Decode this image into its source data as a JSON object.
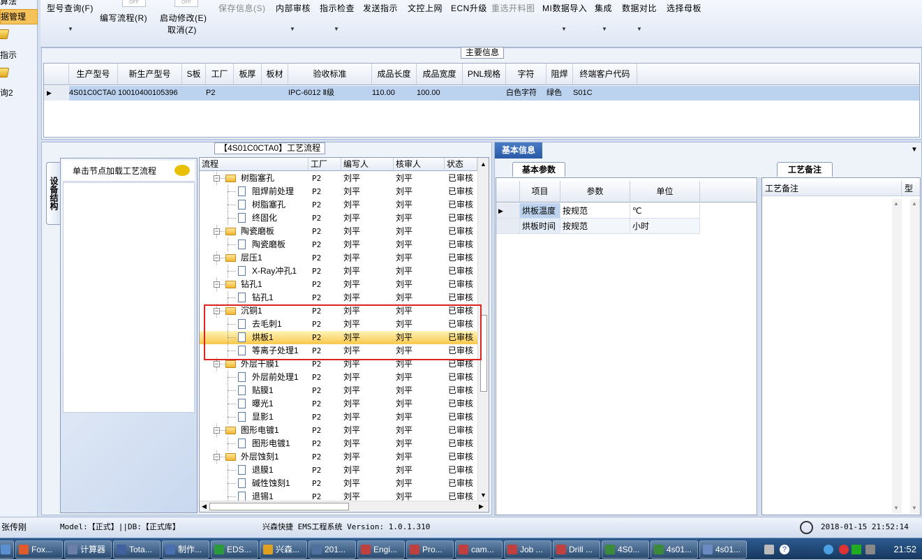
{
  "left_nav": {
    "items": [
      {
        "label": "算法",
        "selected": false
      },
      {
        "label": "据管理",
        "selected": true
      },
      {
        "label": "指示",
        "selected": false
      },
      {
        "label": "询2",
        "selected": false
      }
    ]
  },
  "toolbar": {
    "items": [
      {
        "label": "型号查询(F)",
        "enabled": true
      },
      {
        "label": "编写流程(R)",
        "enabled": true
      },
      {
        "label": "启动修改(E)",
        "enabled": true
      },
      {
        "label": "取消(Z)",
        "enabled": true
      },
      {
        "label": "保存信息(S)",
        "enabled": false
      },
      {
        "label": "内部审核",
        "enabled": true
      },
      {
        "label": "指示检查",
        "enabled": true
      },
      {
        "label": "发送指示",
        "enabled": true
      },
      {
        "label": "文控上网",
        "enabled": true
      },
      {
        "label": "ECN升级",
        "enabled": true
      },
      {
        "label": "重选开料图",
        "enabled": false
      },
      {
        "label": "MI数据导入",
        "enabled": true
      },
      {
        "label": "集成",
        "enabled": true
      },
      {
        "label": "数据对比",
        "enabled": true
      },
      {
        "label": "选择母板",
        "enabled": true
      }
    ],
    "off_label": "OFF"
  },
  "main_info": {
    "title": "主要信息",
    "columns": [
      "生产型号",
      "新生产型号",
      "S板",
      "工厂",
      "板厚",
      "板材",
      "验收标准",
      "成品长度",
      "成品宽度",
      "PNL规格",
      "字符",
      "阻焊",
      "终端客户代码"
    ],
    "rows": [
      [
        "4S01C0CTA0",
        "10010400105396",
        "",
        "P2",
        "",
        "",
        "IPC-6012 Ⅱ级",
        "110.00",
        "100.00",
        "",
        "白色字符",
        "绿色",
        "S01C"
      ]
    ]
  },
  "process": {
    "title": "【4S01C0CTA0】工艺流程",
    "side_tab": "设备结构",
    "node_hint": "单击节点加载工艺流程",
    "columns": [
      "流程",
      "工厂",
      "编写人",
      "核审人",
      "状态"
    ],
    "rows": [
      {
        "name": "树脂塞孔",
        "level": 0,
        "factory": "P2",
        "writer": "刘平",
        "reviewer": "刘平",
        "status": "已审核"
      },
      {
        "name": "阻焊前处理",
        "level": 1,
        "factory": "P2",
        "writer": "刘平",
        "reviewer": "刘平",
        "status": "已审核"
      },
      {
        "name": "树脂塞孔",
        "level": 1,
        "factory": "P2",
        "writer": "刘平",
        "reviewer": "刘平",
        "status": "已审核"
      },
      {
        "name": "终固化",
        "level": 1,
        "factory": "P2",
        "writer": "刘平",
        "reviewer": "刘平",
        "status": "已审核"
      },
      {
        "name": "陶瓷磨板",
        "level": 0,
        "factory": "P2",
        "writer": "刘平",
        "reviewer": "刘平",
        "status": "已审核"
      },
      {
        "name": "陶瓷磨板",
        "level": 1,
        "factory": "P2",
        "writer": "刘平",
        "reviewer": "刘平",
        "status": "已审核"
      },
      {
        "name": "层压1",
        "level": 0,
        "factory": "P2",
        "writer": "刘平",
        "reviewer": "刘平",
        "status": "已审核"
      },
      {
        "name": "X-Ray冲孔1",
        "level": 1,
        "factory": "P2",
        "writer": "刘平",
        "reviewer": "刘平",
        "status": "已审核"
      },
      {
        "name": "钻孔1",
        "level": 0,
        "factory": "P2",
        "writer": "刘平",
        "reviewer": "刘平",
        "status": "已审核"
      },
      {
        "name": "钻孔1",
        "level": 1,
        "factory": "P2",
        "writer": "刘平",
        "reviewer": "刘平",
        "status": "已审核"
      },
      {
        "name": "沉铜1",
        "level": 0,
        "factory": "P2",
        "writer": "刘平",
        "reviewer": "刘平",
        "status": "已审核"
      },
      {
        "name": "去毛刺1",
        "level": 1,
        "factory": "P2",
        "writer": "刘平",
        "reviewer": "刘平",
        "status": "已审核"
      },
      {
        "name": "烘板1",
        "level": 1,
        "factory": "P2",
        "writer": "刘平",
        "reviewer": "刘平",
        "status": "已审核",
        "selected": true
      },
      {
        "name": "等离子处理1",
        "level": 1,
        "factory": "P2",
        "writer": "刘平",
        "reviewer": "刘平",
        "status": "已审核"
      },
      {
        "name": "外层干膜1",
        "level": 0,
        "factory": "P2",
        "writer": "刘平",
        "reviewer": "刘平",
        "status": "已审核"
      },
      {
        "name": "外层前处理1",
        "level": 1,
        "factory": "P2",
        "writer": "刘平",
        "reviewer": "刘平",
        "status": "已审核"
      },
      {
        "name": "贴膜1",
        "level": 1,
        "factory": "P2",
        "writer": "刘平",
        "reviewer": "刘平",
        "status": "已审核"
      },
      {
        "name": "曝光1",
        "level": 1,
        "factory": "P2",
        "writer": "刘平",
        "reviewer": "刘平",
        "status": "已审核"
      },
      {
        "name": "显影1",
        "level": 1,
        "factory": "P2",
        "writer": "刘平",
        "reviewer": "刘平",
        "status": "已审核"
      },
      {
        "name": "图形电镀1",
        "level": 0,
        "factory": "P2",
        "writer": "刘平",
        "reviewer": "刘平",
        "status": "已审核"
      },
      {
        "name": "图形电镀1",
        "level": 1,
        "factory": "P2",
        "writer": "刘平",
        "reviewer": "刘平",
        "status": "已审核"
      },
      {
        "name": "外层蚀刻1",
        "level": 0,
        "factory": "P2",
        "writer": "刘平",
        "reviewer": "刘平",
        "status": "已审核"
      },
      {
        "name": "退膜1",
        "level": 1,
        "factory": "P2",
        "writer": "刘平",
        "reviewer": "刘平",
        "status": "已审核"
      },
      {
        "name": "碱性蚀刻1",
        "level": 1,
        "factory": "P2",
        "writer": "刘平",
        "reviewer": "刘平",
        "status": "已审核"
      },
      {
        "name": "退锡1",
        "level": 1,
        "factory": "P2",
        "writer": "刘平",
        "reviewer": "刘平",
        "status": "已审核"
      }
    ]
  },
  "basic_info": {
    "title": "基本信息",
    "param_tab": "基本参数",
    "columns": [
      "项目",
      "参数",
      "单位"
    ],
    "rows": [
      {
        "item": "烘板温度",
        "param": "按规范",
        "unit": "℃"
      },
      {
        "item": "烘板时间",
        "param": "按规范",
        "unit": "小时"
      }
    ],
    "notes_tab": "工艺备注",
    "notes_columns": [
      "工艺备注",
      "型"
    ]
  },
  "status_bar": {
    "user": "张传刚",
    "model": "Model:【正式】||DB:【正式库】",
    "system": "兴森快捷 EMS工程系统 Version: 1.0.1.310",
    "datetime": "2018-01-15 21:52:14"
  },
  "taskbar": {
    "items": [
      "...",
      "Fox...",
      "计算器",
      "Tota...",
      "制作...",
      "EDS...",
      "兴森...",
      "201...",
      "Engi...",
      "Pro...",
      "cam...",
      "Job ...",
      "Drill ...",
      "4S0...",
      "4s01...",
      "4s01..."
    ],
    "clock": "21:52"
  },
  "colors": {
    "accent": "#2a5aa6",
    "selected_row": "#f8c84a",
    "grid_selected": "#bcd3ef",
    "highlight_box": "#dd2222"
  }
}
